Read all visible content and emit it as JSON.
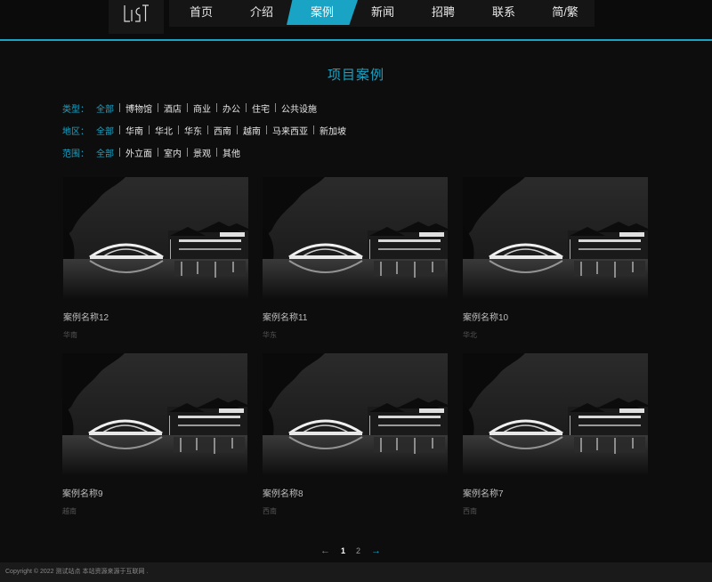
{
  "header": {
    "logo_text": "LIGHT",
    "nav": [
      {
        "label": "首页"
      },
      {
        "label": "介绍"
      },
      {
        "label": "案例"
      },
      {
        "label": "新闻"
      },
      {
        "label": "招聘"
      },
      {
        "label": "联系"
      },
      {
        "label": "简/繁"
      }
    ],
    "active_index": 2
  },
  "page_title": "项目案例",
  "filters": {
    "type": {
      "label": "类型：",
      "options": [
        "全部",
        "博物馆",
        "酒店",
        "商业",
        "办公",
        "住宅",
        "公共设施"
      ],
      "active": 0
    },
    "region": {
      "label": "地区：",
      "options": [
        "全部",
        "华南",
        "华北",
        "华东",
        "西南",
        "越南",
        "马来西亚",
        "新加坡"
      ],
      "active": 0
    },
    "scope": {
      "label": "范围：",
      "options": [
        "全部",
        "外立面",
        "室内",
        "景观",
        "其他"
      ],
      "active": 0
    }
  },
  "cases": [
    {
      "name": "案例名称12",
      "region": "华南"
    },
    {
      "name": "案例名称11",
      "region": "华东"
    },
    {
      "name": "案例名称10",
      "region": "华北"
    },
    {
      "name": "案例名称9",
      "region": "越南"
    },
    {
      "name": "案例名称8",
      "region": "西南"
    },
    {
      "name": "案例名称7",
      "region": "西南"
    }
  ],
  "pagination": {
    "prev": "←",
    "pages": [
      "1",
      "2"
    ],
    "current": "1",
    "next": "→"
  },
  "footer": {
    "text": "Copyright © 2022 测试站点 本站资源来源于互联网 ."
  },
  "colors": {
    "accent": "#19a3c4",
    "background": "#0d0d0d"
  }
}
